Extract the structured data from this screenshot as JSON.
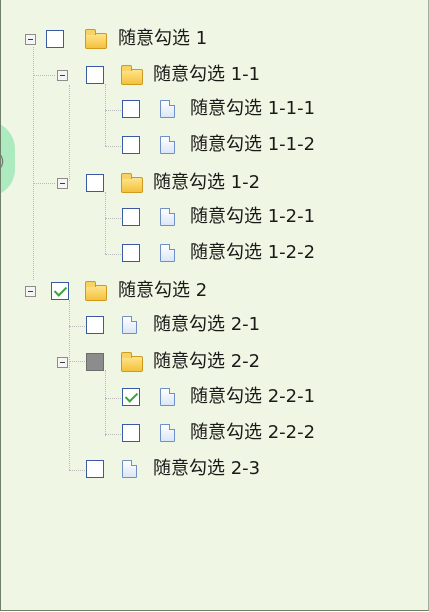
{
  "tree": {
    "nodes": [
      {
        "label": "随意勾选 1",
        "type": "folder",
        "checked": "unchecked",
        "expanded": true
      },
      {
        "label": "随意勾选 1-1",
        "type": "folder",
        "checked": "unchecked",
        "expanded": true
      },
      {
        "label": "随意勾选 1-1-1",
        "type": "file",
        "checked": "unchecked"
      },
      {
        "label": "随意勾选 1-1-2",
        "type": "file",
        "checked": "unchecked"
      },
      {
        "label": "随意勾选 1-2",
        "type": "folder",
        "checked": "unchecked",
        "expanded": true
      },
      {
        "label": "随意勾选 1-2-1",
        "type": "file",
        "checked": "unchecked"
      },
      {
        "label": "随意勾选 1-2-2",
        "type": "file",
        "checked": "unchecked"
      },
      {
        "label": "随意勾选 2",
        "type": "folder",
        "checked": "checked",
        "expanded": true
      },
      {
        "label": "随意勾选 2-1",
        "type": "file",
        "checked": "unchecked"
      },
      {
        "label": "随意勾选 2-2",
        "type": "folder",
        "checked": "partial",
        "expanded": true
      },
      {
        "label": "随意勾选 2-2-1",
        "type": "file",
        "checked": "checked"
      },
      {
        "label": "随意勾选 2-2-2",
        "type": "file",
        "checked": "unchecked"
      },
      {
        "label": "随意勾选 2-3",
        "type": "file",
        "checked": "unchecked"
      }
    ]
  },
  "colors": {
    "panel_bg": "#f0f6e4",
    "checkbox_border": "#3a5aa5",
    "checkmark": "#3aa33a",
    "partial_fill": "#8c8c8c",
    "folder": "#f3c23d"
  }
}
